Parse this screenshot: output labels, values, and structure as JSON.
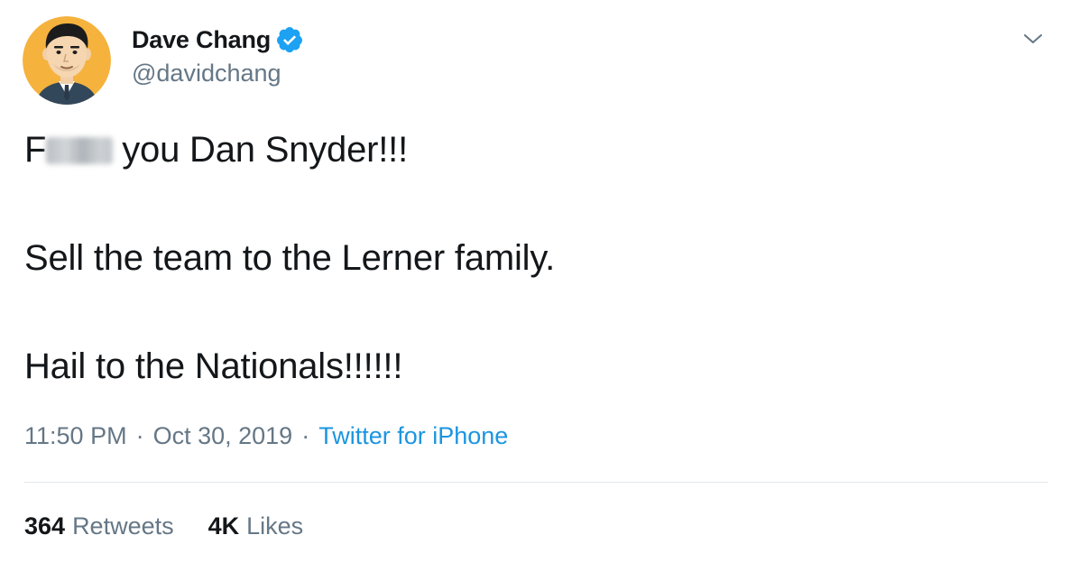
{
  "colors": {
    "text_primary": "#14171a",
    "text_secondary": "#657786",
    "link_blue": "#1b95e0",
    "verified_blue": "#1da1f2",
    "divider": "#e1e8ed",
    "avatar_bg": "#f5b23d"
  },
  "author": {
    "display_name": "Dave Chang",
    "handle": "@davidchang",
    "verified": true,
    "avatar_icon": "cartoon-avatar-icon"
  },
  "menu_icon": "chevron-down-icon",
  "tweet": {
    "line1_visible_prefix": "F",
    "line1_rest": "you Dan Snyder!!!",
    "line2": "Sell the team to the Lerner family.",
    "line3": "Hail to the Nationals!!!!!!"
  },
  "meta": {
    "time": "11:50 PM",
    "separator": "·",
    "date": "Oct 30, 2019",
    "source": "Twitter for iPhone"
  },
  "stats": {
    "retweets_count": "364",
    "retweets_label": "Retweets",
    "likes_count": "4K",
    "likes_label": "Likes"
  }
}
